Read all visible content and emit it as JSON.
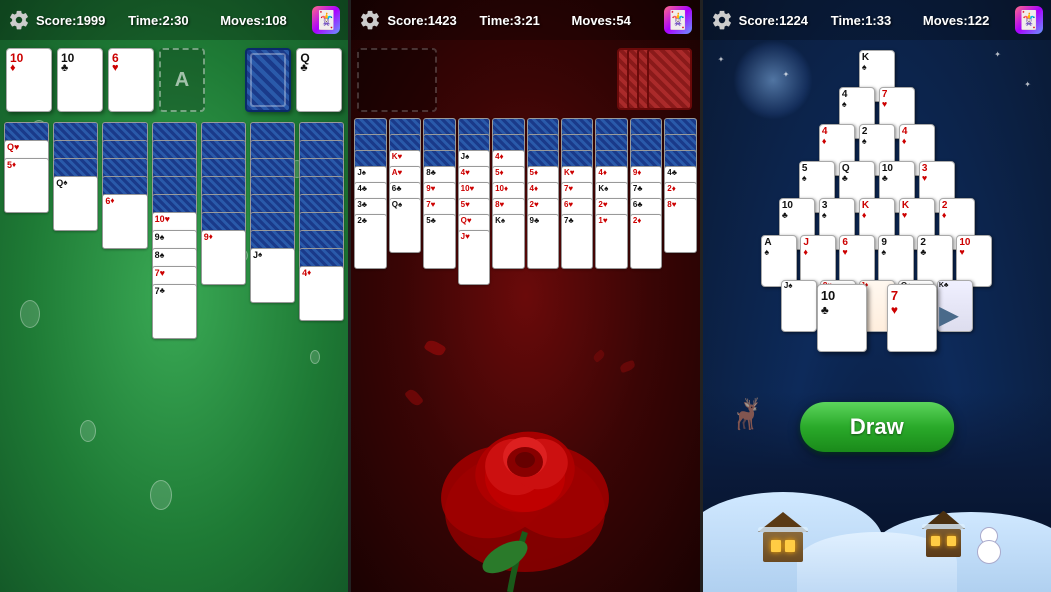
{
  "panel1": {
    "score": "Score:1999",
    "time": "Time:2:30",
    "moves": "Moves:108",
    "gameIcon": "🎮",
    "bgColor": "#2a8a40"
  },
  "panel2": {
    "score": "Score:1423",
    "time": "Time:3:21",
    "moves": "Moves:54",
    "gameIcon": "🎮",
    "bgColor": "#3a0505"
  },
  "panel3": {
    "score": "Score:1224",
    "time": "Time:1:33",
    "moves": "Moves:122",
    "gameIcon": "🎮",
    "bgColor": "#0a1a3a",
    "drawButton": "Draw"
  }
}
